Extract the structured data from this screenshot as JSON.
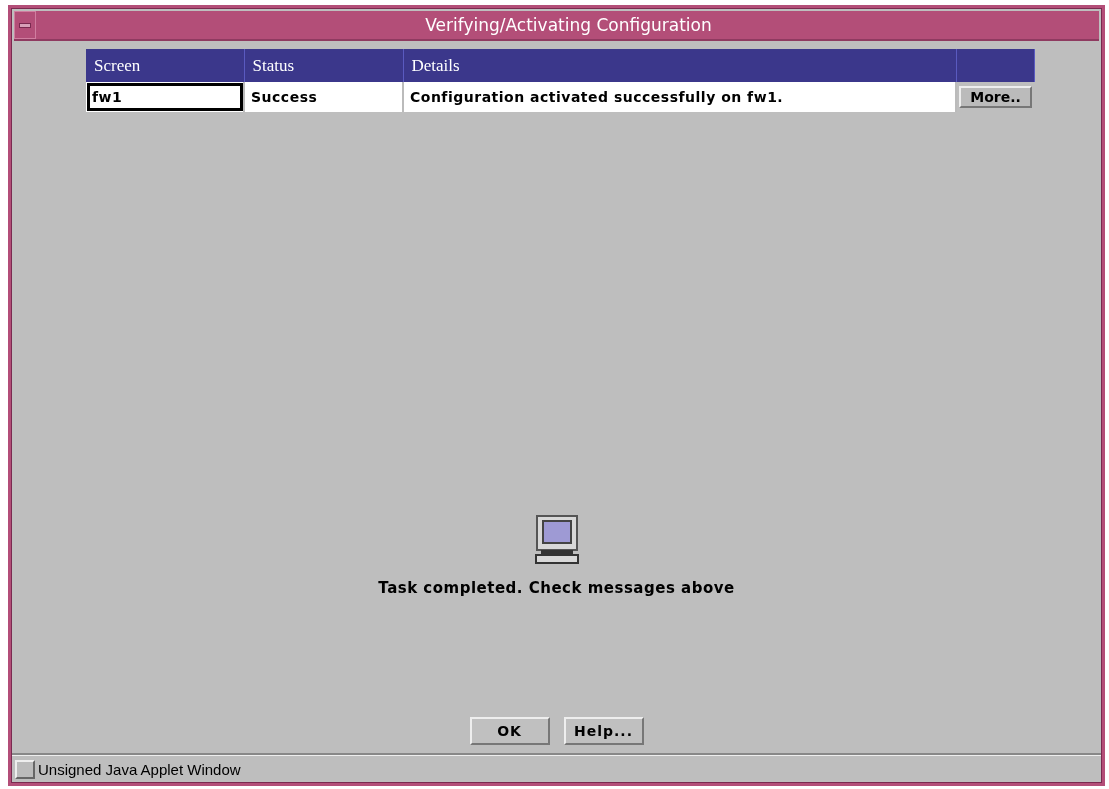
{
  "window": {
    "title": "Verifying/Activating Configuration"
  },
  "table": {
    "columns": [
      "Screen",
      "Status",
      "Details",
      ""
    ],
    "rows": [
      {
        "screen": "fw1",
        "status": "Success",
        "details": "Configuration activated successfully on fw1.",
        "action": "More..",
        "selected": true
      }
    ]
  },
  "message": "Task completed. Check messages above",
  "buttons": [
    "OK",
    "Help..."
  ],
  "status_bar": "Unsigned Java Applet Window"
}
